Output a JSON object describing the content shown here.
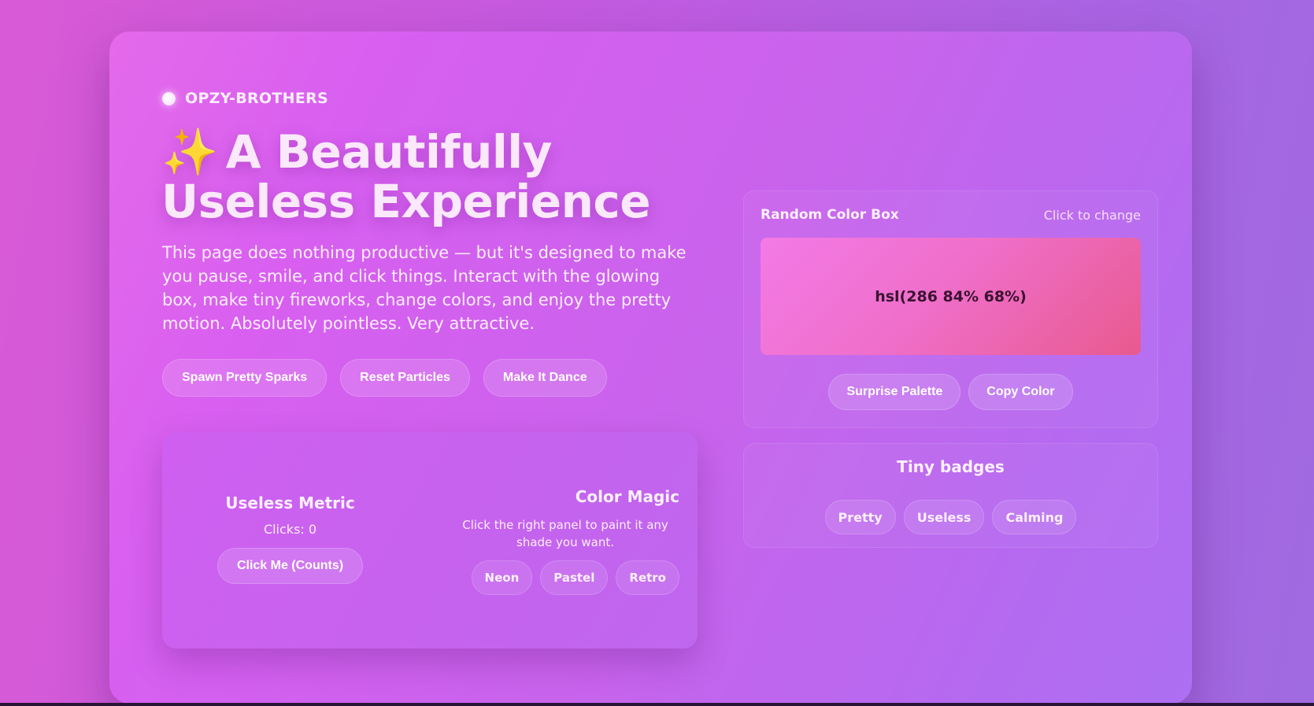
{
  "brand": {
    "name": "OPZY-BROTHERS"
  },
  "hero": {
    "sparkle": "✨",
    "title_line1": "A Beautifully",
    "title_line2": "Useless Experience",
    "description": "This page does nothing productive — but it's designed to make you pause, smile, and click things. Interact with the glowing box, make tiny fireworks, change colors, and enjoy the pretty motion. Absolutely pointless. Very attractive.",
    "actions": [
      "Spawn Pretty Sparks",
      "Reset Particles",
      "Make It Dance"
    ]
  },
  "metric": {
    "title": "Useless Metric",
    "clicks_text": "Clicks: 0",
    "button_label": "Click Me (Counts)"
  },
  "magic": {
    "title": "Color Magic",
    "description": "Click the right panel to paint it any shade you want.",
    "chips": [
      "Neon",
      "Pastel",
      "Retro"
    ]
  },
  "color_box": {
    "title": "Random Color Box",
    "hint": "Click to change",
    "value": "hsl(286 84% 68%)",
    "actions": [
      "Surprise Palette",
      "Copy Color"
    ]
  },
  "badges": {
    "title": "Tiny badges",
    "items": [
      "Pretty",
      "Useless",
      "Calming"
    ]
  }
}
